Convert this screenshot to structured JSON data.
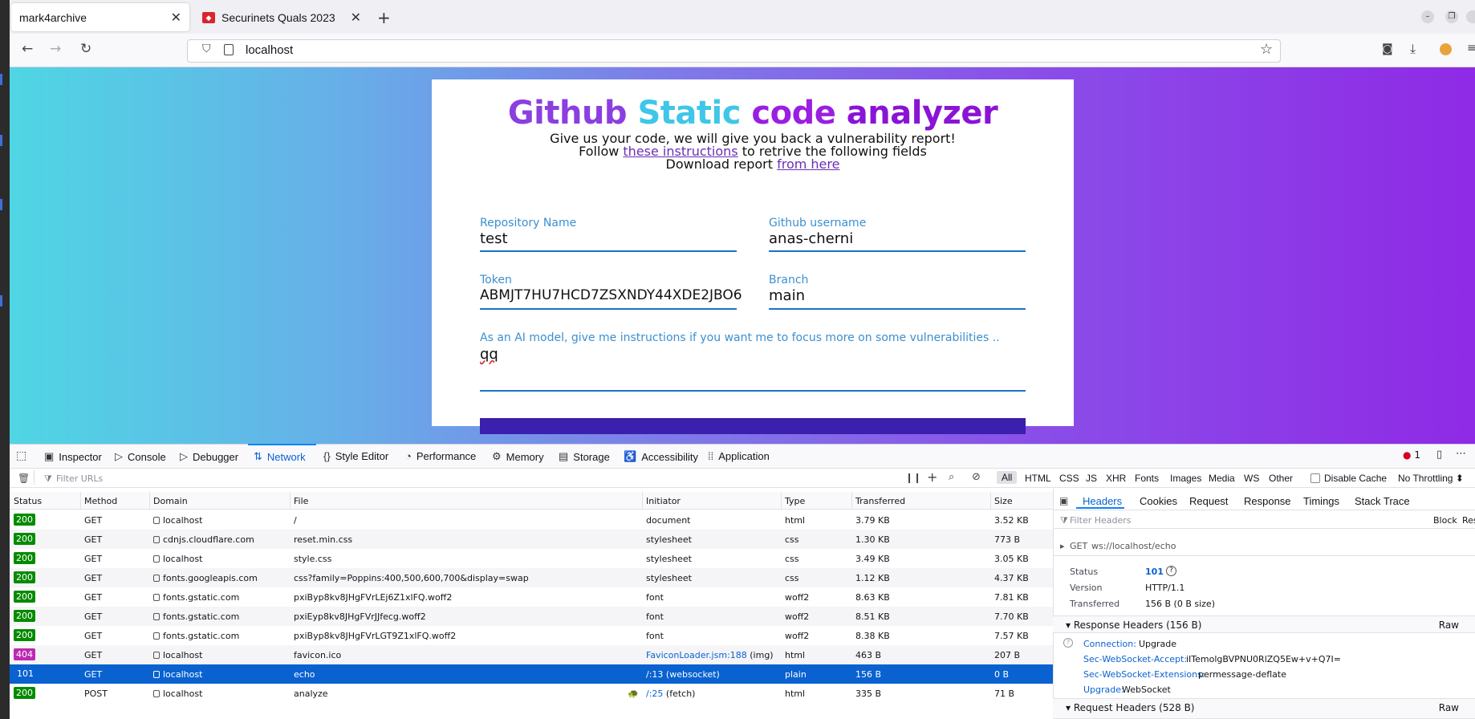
{
  "browser": {
    "tabs": [
      {
        "title": "mark4archive"
      },
      {
        "title": "Securinets Quals 2023"
      }
    ],
    "url": "localhost"
  },
  "page": {
    "title_words": [
      {
        "text": "Github",
        "color": "#8b3fe0"
      },
      {
        "text": "Static",
        "color": "#3fc6e8"
      },
      {
        "text": "code",
        "color": "#9a1fe0"
      },
      {
        "text": "analyzer",
        "color": "#8a14d6"
      }
    ],
    "line1": "Give us your code, we will give you back a vulnerability report!",
    "line2_prefix": "Follow",
    "line2_link": "these instructions",
    "line2_suffix": "to retrive the following fields",
    "line3_prefix": "Download report",
    "line3_link": "from here",
    "fields": {
      "repo": {
        "label": "Repository Name",
        "value": "test"
      },
      "username": {
        "label": "Github username",
        "value": "anas-cherni"
      },
      "token": {
        "label": "Token",
        "value": "ABMJT7HU7HCD7ZSXNDY44XDE2JBO6"
      },
      "branch": {
        "label": "Branch",
        "value": "main"
      },
      "instructions": {
        "label": "As an AI model, give me instructions if you want me to focus more on some vulnerabilities ..",
        "value": "qq"
      }
    }
  },
  "devtools": {
    "tabs": [
      "Inspector",
      "Console",
      "Debugger",
      "Network",
      "Style Editor",
      "Performance",
      "Memory",
      "Storage",
      "Accessibility",
      "Application"
    ],
    "error_count": "1",
    "filter_placeholder": "Filter URLs",
    "types": [
      "All",
      "HTML",
      "CSS",
      "JS",
      "XHR",
      "Fonts",
      "Images",
      "Media",
      "WS",
      "Other"
    ],
    "disable_cache": "Disable Cache",
    "throttling": "No Throttling ⬍",
    "columns": [
      "Status",
      "Method",
      "Domain",
      "File",
      "Initiator",
      "Type",
      "Transferred",
      "Size"
    ],
    "requests": [
      {
        "status": "200",
        "method": "GET",
        "domain": "localhost",
        "file": "/",
        "initiator": "document",
        "type": "html",
        "transferred": "3.79 KB",
        "size": "3.52 KB"
      },
      {
        "status": "200",
        "method": "GET",
        "domain": "cdnjs.cloudflare.com",
        "file": "reset.min.css",
        "initiator": "stylesheet",
        "type": "css",
        "transferred": "1.30 KB",
        "size": "773 B"
      },
      {
        "status": "200",
        "method": "GET",
        "domain": "localhost",
        "file": "style.css",
        "initiator": "stylesheet",
        "type": "css",
        "transferred": "3.49 KB",
        "size": "3.05 KB"
      },
      {
        "status": "200",
        "method": "GET",
        "domain": "fonts.googleapis.com",
        "file": "css?family=Poppins:400,500,600,700&display=swap",
        "initiator": "stylesheet",
        "type": "css",
        "transferred": "1.12 KB",
        "size": "4.37 KB"
      },
      {
        "status": "200",
        "method": "GET",
        "domain": "fonts.gstatic.com",
        "file": "pxiByp8kv8JHgFVrLEj6Z1xlFQ.woff2",
        "initiator": "font",
        "type": "woff2",
        "transferred": "8.63 KB",
        "size": "7.81 KB"
      },
      {
        "status": "200",
        "method": "GET",
        "domain": "fonts.gstatic.com",
        "file": "pxiEyp8kv8JHgFVrJJfecg.woff2",
        "initiator": "font",
        "type": "woff2",
        "transferred": "8.51 KB",
        "size": "7.70 KB"
      },
      {
        "status": "200",
        "method": "GET",
        "domain": "fonts.gstatic.com",
        "file": "pxiByp8kv8JHgFVrLGT9Z1xlFQ.woff2",
        "initiator": "font",
        "type": "woff2",
        "transferred": "8.38 KB",
        "size": "7.57 KB"
      },
      {
        "status": "404",
        "method": "GET",
        "domain": "localhost",
        "file": "favicon.ico",
        "initiator_link": "FaviconLoader.jsm:188",
        "initiator": "(img)",
        "type": "html",
        "transferred": "463 B",
        "size": "207 B"
      },
      {
        "status": "101",
        "method": "GET",
        "domain": "localhost",
        "file": "echo",
        "initiator_link": "/:13",
        "initiator": "(websocket)",
        "type": "plain",
        "transferred": "156 B",
        "size": "0 B"
      },
      {
        "status": "200",
        "method": "POST",
        "domain": "localhost",
        "file": "analyze",
        "initiator_link": "/:25",
        "initiator": "(fetch)",
        "type": "html",
        "transferred": "335 B",
        "size": "71 B"
      }
    ],
    "side": {
      "tabs": [
        "Headers",
        "Cookies",
        "Request",
        "Response",
        "Timings",
        "Stack Trace"
      ],
      "filter_placeholder": "Filter Headers",
      "block": "Block",
      "res": "Res",
      "request_line_method": "GET",
      "request_line_url": "ws://localhost/echo",
      "status_key": "Status",
      "status_val": "101",
      "version_key": "Version",
      "version_val": "HTTP/1.1",
      "transferred_key": "Transferred",
      "transferred_val": "156 B (0 B size)",
      "response_headers_title": "Response Headers (156 B)",
      "raw": "Raw",
      "headers": [
        {
          "k": "Connection:",
          "v": "Upgrade"
        },
        {
          "k": "Sec-WebSocket-Accept:",
          "v": "iITemolgBVPNU0RlZQ5Ew+v+Q7I="
        },
        {
          "k": "Sec-WebSocket-Extensions:",
          "v": "permessage-deflate"
        },
        {
          "k": "Upgrade:",
          "v": "WebSocket"
        }
      ],
      "request_headers_title": "Request Headers (528 B)"
    }
  }
}
